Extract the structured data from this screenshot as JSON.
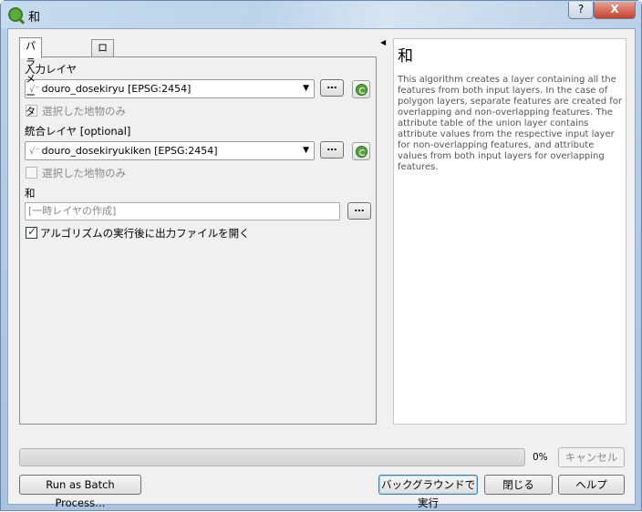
{
  "window": {
    "title": "和",
    "help_btn": "?",
    "close_btn": "X"
  },
  "tabs": [
    {
      "label": "パラメーター"
    },
    {
      "label": "ログ"
    }
  ],
  "params": {
    "input_layer": {
      "label": "入力レイヤ",
      "value": "douro_dosekiryu [EPSG:2454]",
      "dots": "…"
    },
    "input_selected_only": {
      "label": "選択した地物のみ",
      "checked": false
    },
    "overlay_layer": {
      "label": "統合レイヤ [optional]",
      "value": "douro_dosekiryukiken [EPSG:2454]",
      "dots": "…"
    },
    "overlay_selected_only": {
      "label": "選択した地物のみ",
      "checked": false
    },
    "output": {
      "label": "和",
      "placeholder": "[一時レイヤの作成]",
      "dots": "…"
    },
    "open_after": {
      "label": "アルゴリズムの実行後に出力ファイルを開く",
      "checked": true,
      "mark": "✓"
    }
  },
  "help": {
    "title": "和",
    "text": "This algorithm creates a layer containing all the features from both input layers. In the case of polygon layers, separate features are created for overlapping and non-overlapping features. The attribute table of the union layer contains attribute values from the respective input layer for non-overlapping features, and attribute values from both input layers for overlapping features."
  },
  "progress": {
    "value": 0,
    "label": "0%"
  },
  "buttons": {
    "cancel": "キャンセル",
    "batch": "Run as Batch Process…",
    "run_background": "バックグラウンドで実行",
    "close": "閉じる",
    "help": "ヘルプ"
  }
}
